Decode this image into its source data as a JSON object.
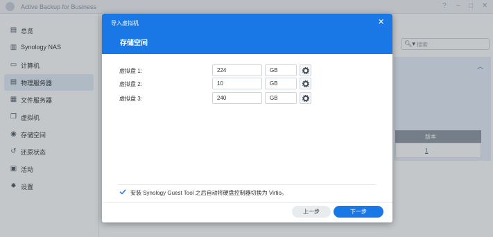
{
  "app": {
    "title": "Active Backup for Business",
    "help_glyph": "?",
    "minimize_glyph": "−",
    "maximize_glyph": "□",
    "close_glyph": "✕"
  },
  "sidebar": {
    "items": [
      {
        "label": "总览",
        "icon": "overview-icon",
        "active": false
      },
      {
        "label": "Synology NAS",
        "icon": "nas-icon",
        "active": false
      },
      {
        "label": "计算机",
        "icon": "computer-icon",
        "active": false
      },
      {
        "label": "物理服务器",
        "icon": "server-icon",
        "active": true
      },
      {
        "label": "文件服务器",
        "icon": "file-server-icon",
        "active": false
      },
      {
        "label": "虚拟机",
        "icon": "vm-icon",
        "active": false
      },
      {
        "label": "存储空间",
        "icon": "storage-icon",
        "active": false
      },
      {
        "label": "还原状态",
        "icon": "restore-icon",
        "active": false
      },
      {
        "label": "活动",
        "icon": "activity-icon",
        "active": false
      },
      {
        "label": "设置",
        "icon": "settings-icon",
        "active": false
      }
    ]
  },
  "main": {
    "search_placeholder": "搜索",
    "table_header_version": "版本",
    "table_row_version": "1"
  },
  "modal": {
    "title": "导入虚拟机",
    "step_title": "存储空间",
    "close_glyph": "✕",
    "disks": [
      {
        "label": "虚拟盘 1:",
        "value": "224",
        "unit": "GB"
      },
      {
        "label": "虚拟盘 2:",
        "value": "10",
        "unit": "GB"
      },
      {
        "label": "虚拟盘 3:",
        "value": "240",
        "unit": "GB"
      }
    ],
    "checkbox_label": "安装 Synology Guest Tool 之后自动将硬盘控制器切换为 Virtio。",
    "checkbox_checked": true,
    "prev_label": "上一步",
    "next_label": "下一步"
  },
  "colors": {
    "accent": "#1a78e6",
    "sidebar_active": "#e1ecf8"
  }
}
